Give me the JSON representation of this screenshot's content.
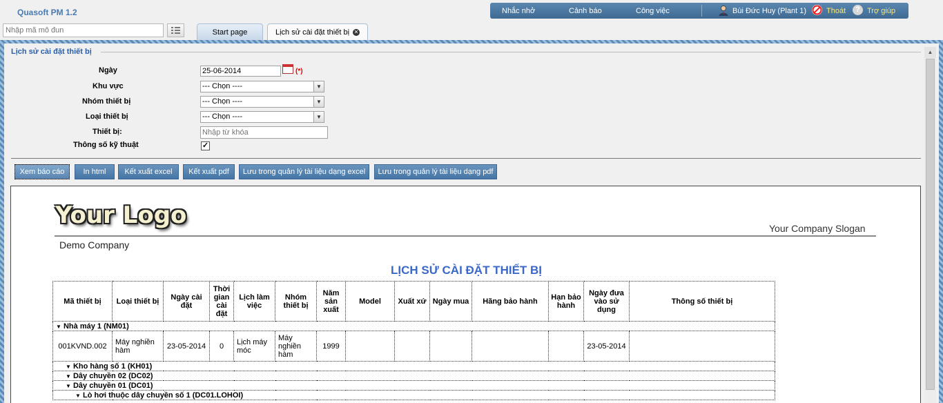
{
  "app": {
    "title": "Quasoft PM 1.2"
  },
  "topnav": {
    "items": [
      "Nhắc nhở",
      "Cảnh báo",
      "Công việc"
    ],
    "user": "Bùi Đức Huy (Plant 1)",
    "logout": "Thoát",
    "help": "Trợ giúp",
    "icons": [
      "user-icon",
      "logout-icon",
      "help-icon"
    ]
  },
  "toolbar": {
    "module_placeholder": "Nhập mã mô đun"
  },
  "tabs": [
    {
      "label": "Start page"
    },
    {
      "label": "Lịch sử cài đặt thiết bị"
    }
  ],
  "form": {
    "title": "Lịch sử cài đặt thiết bị",
    "date_label": "Ngày",
    "date_value": "25-06-2014",
    "required_mark": "(*)",
    "area_label": "Khu vực",
    "area_value": "--- Chọn ----",
    "group_label": "Nhóm thiết bị",
    "group_value": "--- Chọn ----",
    "type_label": "Loại thiết bị",
    "type_value": "--- Chọn ----",
    "device_label": "Thiết bị:",
    "device_placeholder": "Nhập từ khóa",
    "spec_label": "Thông số kỹ thuật",
    "spec_checked": true
  },
  "buttons": [
    "Xem báo cáo",
    "In html",
    "Kết xuất excel",
    "Kết xuất pdf",
    "Lưu trong quản lý tài liệu dạng excel",
    "Lưu trong quản lý tài liệu dạng pdf"
  ],
  "report": {
    "logo": "Your Logo",
    "slogan": "Your Company Slogan",
    "company": "Demo Company",
    "title": "LỊCH SỬ CÀI ĐẶT THIẾT BỊ",
    "columns": [
      "Mã thiết bị",
      "Loại thiết bị",
      "Ngày cài đặt",
      "Thời gian cài đặt",
      "Lịch làm việc",
      "Nhóm thiết bị",
      "Năm sản xuất",
      "Model",
      "Xuất xứ",
      "Ngày mua",
      "Hãng bảo hành",
      "Hạn bảo hành",
      "Ngày đưa vào sử dụng",
      "Thông số thiết bị"
    ],
    "groups": {
      "g1": "Nhà máy 1 (NM01)",
      "g2": "Kho hàng số 1 (KH01)",
      "g3": "Dây chuyền 02 (DC02)",
      "g4": "Dây chuyền 01 (DC01)",
      "g5": "Lò hơi thuộc dây chuyền số 1 (DC01.LOHOI)"
    },
    "row1": {
      "code": "001KVND.002",
      "type": "Máy nghiền hàm",
      "install_date": "23-05-2014",
      "install_time": "0",
      "schedule": "Lịch máy móc",
      "group": "Máy nghiền hàm",
      "year": "1999",
      "model": "",
      "origin": "",
      "purchase_date": "",
      "warranty_vendor": "",
      "warranty_term": "",
      "in_use_date": "23-05-2014",
      "spec": ""
    }
  },
  "colors": {
    "accent": "#4576a5",
    "title_blue": "#3a68c8",
    "legend_blue": "#2a5ea8"
  }
}
